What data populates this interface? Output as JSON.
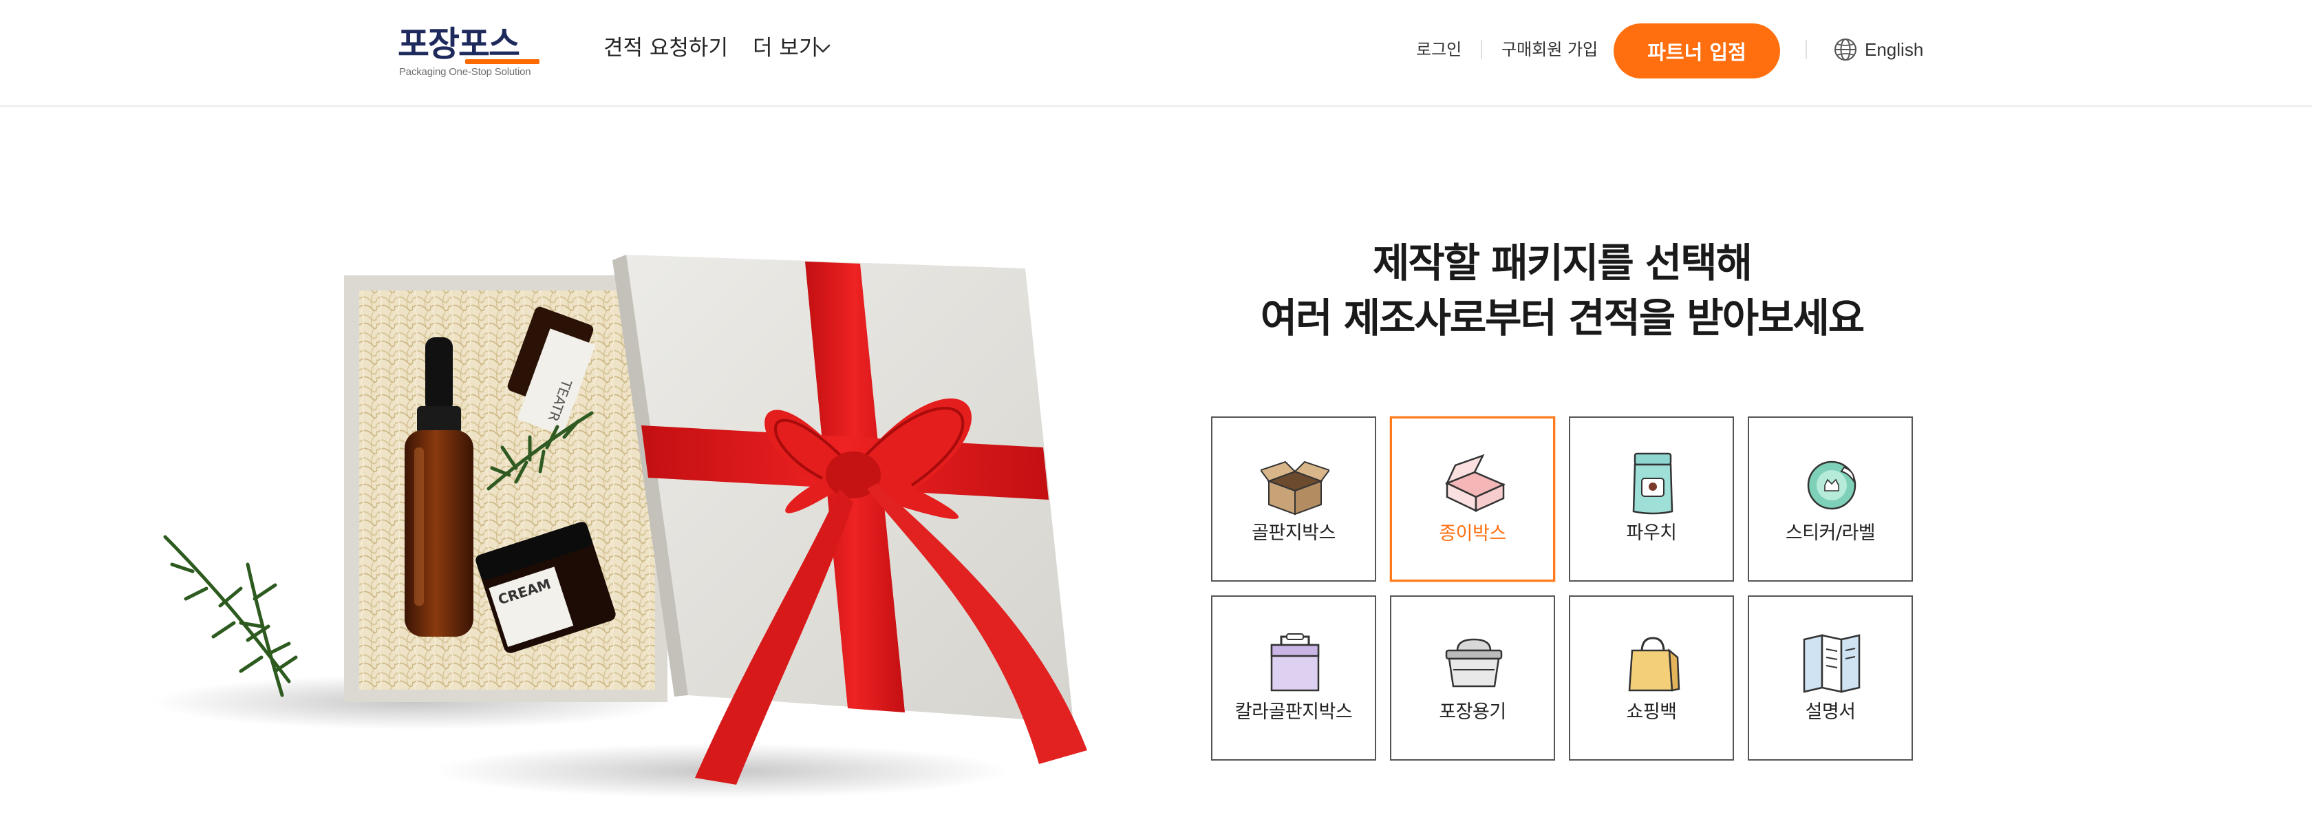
{
  "header": {
    "logo": {
      "title": "포장포스",
      "tagline": "Packaging One-Stop Solution"
    },
    "nav": {
      "quote_request": "견적 요청하기",
      "more": "더 보기"
    },
    "login": "로그인",
    "buyer_signup": "구매회원 가입",
    "partner_button": "파트너 입점",
    "language": "English"
  },
  "hero": {
    "headline_line1": "제작할 패키지를 선택해",
    "headline_line2": "여러 제조사로부터 견적을 받아보세요",
    "product_labels": {
      "dropper_bottle": "TEATR",
      "cream_jar": "CREAM"
    }
  },
  "categories": [
    {
      "label": "골판지박스",
      "icon": "corrugated-box-icon",
      "selected": false
    },
    {
      "label": "종이박스",
      "icon": "paper-box-icon",
      "selected": true
    },
    {
      "label": "파우치",
      "icon": "pouch-icon",
      "selected": false
    },
    {
      "label": "스티커/라벨",
      "icon": "sticker-label-icon",
      "selected": false
    },
    {
      "label": "칼라골판지박스",
      "icon": "color-corrugated-box-icon",
      "selected": false
    },
    {
      "label": "포장용기",
      "icon": "food-container-icon",
      "selected": false
    },
    {
      "label": "쇼핑백",
      "icon": "shopping-bag-icon",
      "selected": false
    },
    {
      "label": "설명서",
      "icon": "manual-icon",
      "selected": false
    }
  ],
  "colors": {
    "accent": "#ff6f0f",
    "brand_navy": "#1f2a5c",
    "ribbon_red": "#e51b1b"
  }
}
